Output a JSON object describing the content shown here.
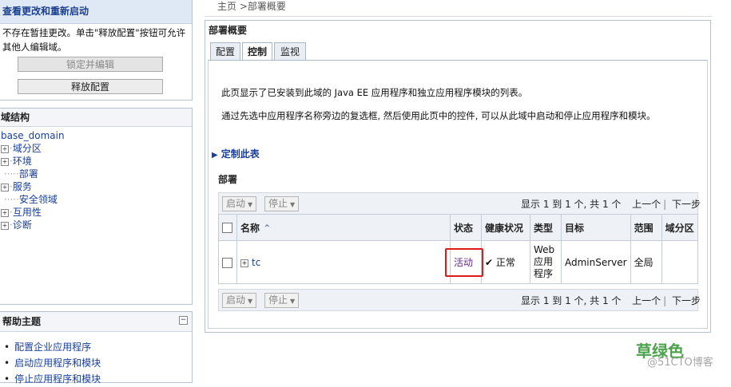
{
  "change_center": {
    "title": "查看更改和重新启动",
    "message": "不存在暂挂更改。单击\"释放配置\"按钮可允许其他人编辑域。",
    "lock_button": "锁定并编辑",
    "release_button": "释放配置"
  },
  "domain_structure": {
    "title": "域结构",
    "root": "base_domain",
    "items": [
      {
        "label": "域分区",
        "expandable": true
      },
      {
        "label": "环境",
        "expandable": true
      },
      {
        "label": "部署",
        "expandable": false
      },
      {
        "label": "服务",
        "expandable": true
      },
      {
        "label": "安全领域",
        "expandable": false
      },
      {
        "label": "互用性",
        "expandable": true
      },
      {
        "label": "诊断",
        "expandable": true
      }
    ]
  },
  "help_topics": {
    "title": "帮助主题",
    "items": [
      "配置企业应用程序",
      "启动应用程序和模块",
      "停止应用程序和模块"
    ]
  },
  "breadcrumb": {
    "home": "主页",
    "sep": " >",
    "current": "部署概要"
  },
  "main": {
    "title": "部署概要",
    "tabs": [
      "配置",
      "控制",
      "监视"
    ],
    "active_tab": "控制",
    "paragraph1": "此页显示了已安装到此域的 Java EE 应用程序和独立应用程序模块的列表。",
    "paragraph2": "通过先选中应用程序名称旁边的复选框, 然后使用此页中的控件, 可以从此域中启动和停止应用程序和模块。",
    "customize_link": "定制此表",
    "section_title": "部署",
    "toolbar": {
      "start_button": "启动",
      "stop_button": "停止",
      "pager_info": "显示 1 到 1 个, 共 1 个",
      "prev": "上一个",
      "next": "下一步"
    },
    "table": {
      "headers": {
        "name": "名称",
        "status": "状态",
        "health": "健康状况",
        "type": "类型",
        "target": "目标",
        "scope": "范围",
        "partition": "域分区"
      },
      "rows": [
        {
          "name": "tc",
          "status": "活动",
          "health": "正常",
          "type": "Web 应用程序",
          "target": "AdminServer",
          "scope": "全局",
          "partition": ""
        }
      ]
    }
  },
  "watermark": {
    "brand_cn": "草绿色",
    "site": "@51CTO博客"
  },
  "colors": {
    "link": "#1a3f9a",
    "status_active": "#6a2b91",
    "highlight": "#e01a1a",
    "header_bg": "#dfe8f5"
  },
  "icons": [
    "expand-plus-icon",
    "triangle-right-icon",
    "sort-ascending-icon",
    "checkmark-icon",
    "collapse-icon",
    "dropdown-caret-icon"
  ]
}
